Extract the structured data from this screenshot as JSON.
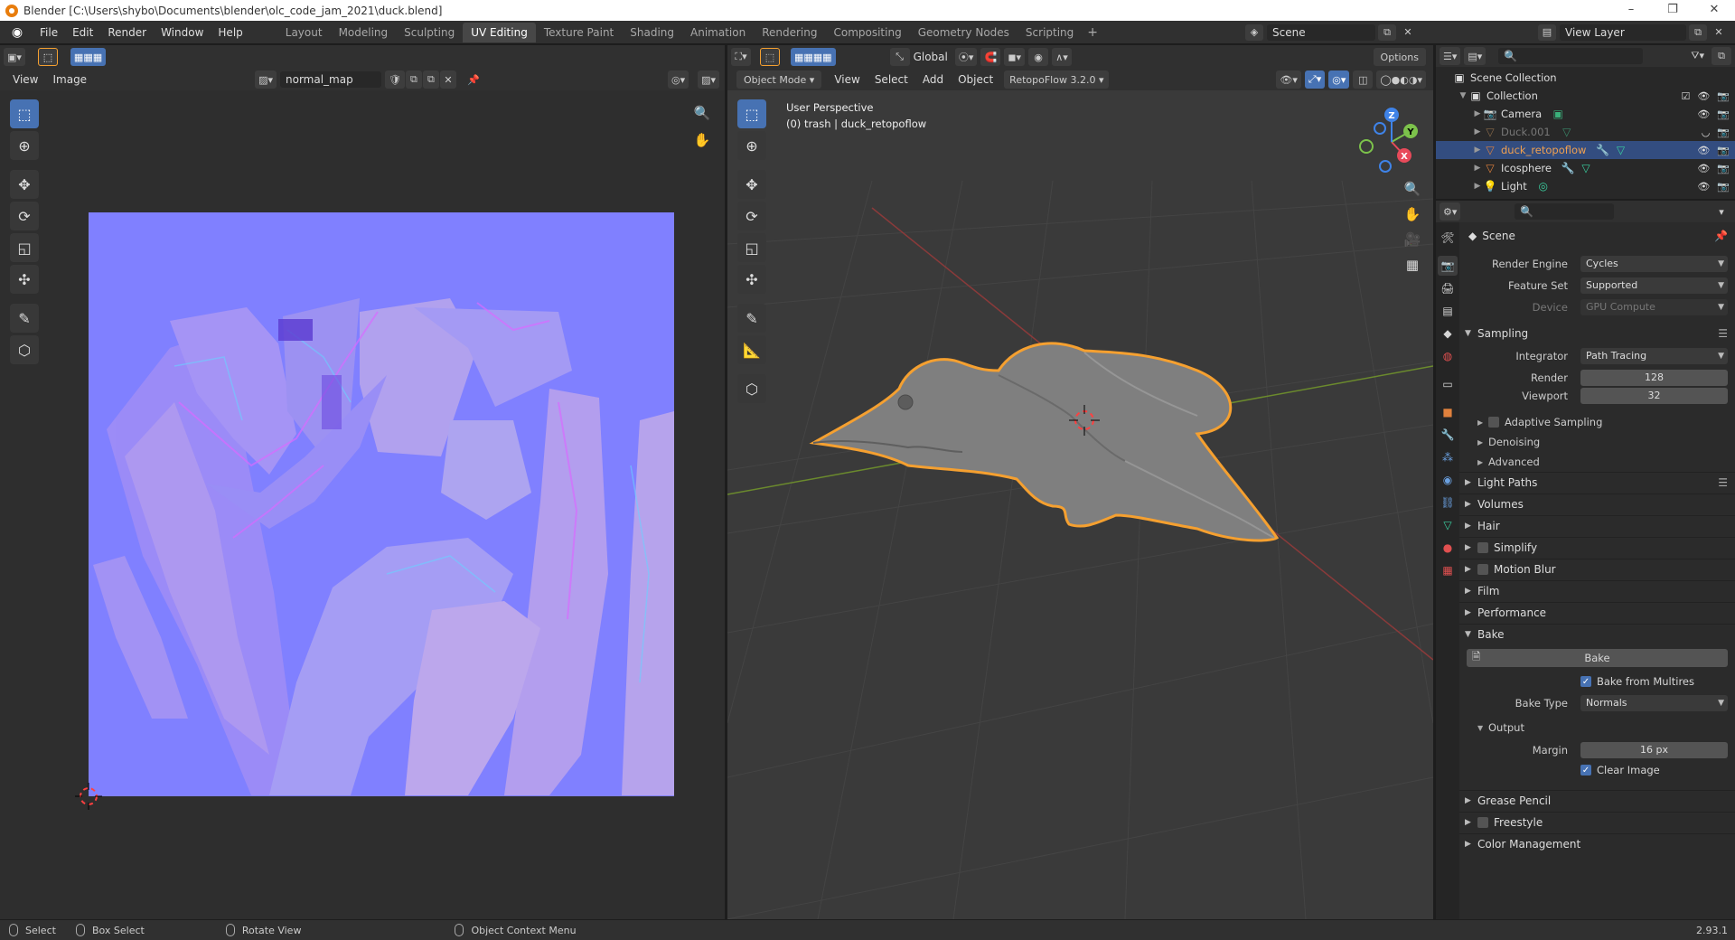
{
  "window": {
    "title": "Blender [C:\\Users\\shybo\\Documents\\blender\\olc_code_jam_2021\\duck.blend]",
    "buttons": [
      "–",
      "❐",
      "✕"
    ]
  },
  "menubar": {
    "items": [
      "File",
      "Edit",
      "Render",
      "Window",
      "Help"
    ],
    "workspaces": [
      "Layout",
      "Modeling",
      "Sculpting",
      "UV Editing",
      "Texture Paint",
      "Shading",
      "Animation",
      "Rendering",
      "Compositing",
      "Geometry Nodes",
      "Scripting"
    ],
    "active_workspace": "UV Editing",
    "scene": "Scene",
    "view_layer": "View Layer"
  },
  "uv_editor": {
    "view_menu": "View",
    "image_menu": "Image",
    "image_name": "normal_map"
  },
  "viewport": {
    "mode": "Object Mode",
    "menus": [
      "View",
      "Select",
      "Add",
      "Object"
    ],
    "addon": "RetopoFlow 3.2.0",
    "orientation": "Global",
    "options": "Options",
    "overlay_title": "User Perspective",
    "overlay_subtitle": "(0) trash | duck_retopoflow",
    "gizmo": {
      "x": "X",
      "y": "Y",
      "z": "Z"
    }
  },
  "outliner": {
    "root": "Scene Collection",
    "collection": "Collection",
    "items": [
      {
        "name": "Camera",
        "icon": "camera-icon",
        "color": "#e0813d"
      },
      {
        "name": "Duck.001",
        "icon": "mesh-icon",
        "color": "#8a6a4a"
      },
      {
        "name": "duck_retopoflow",
        "icon": "mesh-icon",
        "color": "#e0813d"
      },
      {
        "name": "Icosphere",
        "icon": "mesh-icon",
        "color": "#e0813d"
      },
      {
        "name": "Light",
        "icon": "light-icon",
        "color": "#e0813d"
      }
    ],
    "selected": "duck_retopoflow"
  },
  "properties": {
    "context": "Scene",
    "render_engine_label": "Render Engine",
    "render_engine": "Cycles",
    "feature_set_label": "Feature Set",
    "feature_set": "Supported",
    "device_label": "Device",
    "device": "GPU Compute",
    "sampling": "Sampling",
    "integrator_label": "Integrator",
    "integrator": "Path Tracing",
    "render_label": "Render",
    "render_samples": "128",
    "viewport_label": "Viewport",
    "viewport_samples": "32",
    "adaptive_sampling": "Adaptive Sampling",
    "denoising": "Denoising",
    "advanced": "Advanced",
    "light_paths": "Light Paths",
    "volumes": "Volumes",
    "hair": "Hair",
    "simplify": "Simplify",
    "motion_blur": "Motion Blur",
    "film": "Film",
    "performance": "Performance",
    "bake": "Bake",
    "bake_button": "Bake",
    "bake_from_multires": "Bake from Multires",
    "bake_type_label": "Bake Type",
    "bake_type": "Normals",
    "output": "Output",
    "margin_label": "Margin",
    "margin": "16 px",
    "clear_image": "Clear Image",
    "grease_pencil": "Grease Pencil",
    "freestyle": "Freestyle",
    "color_management": "Color Management"
  },
  "statusbar": {
    "select": "Select",
    "box_select": "Box Select",
    "rotate_view": "Rotate View",
    "context_menu": "Object Context Menu",
    "version": "2.93.1"
  },
  "colors": {
    "accent": "#4772b3",
    "normal_map_base": "#8080ff",
    "selection_outline": "#f5a030"
  }
}
